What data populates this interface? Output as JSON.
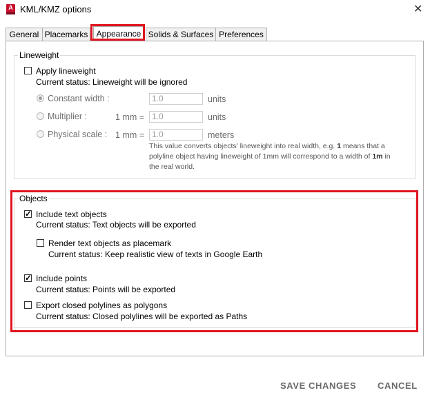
{
  "window": {
    "title": "KML/KMZ options",
    "app_icon_letter": "A"
  },
  "tabs": [
    {
      "label": "General"
    },
    {
      "label": "Placemarks"
    },
    {
      "label": "Appearance"
    },
    {
      "label": "Solids & Surfaces"
    },
    {
      "label": "Preferences"
    }
  ],
  "lineweight": {
    "legend": "Lineweight",
    "apply_label": "Apply lineweight",
    "apply_checked": false,
    "apply_status": "Current status: Lineweight will be ignored",
    "constant": {
      "label": "Constant width :",
      "value": "1.0",
      "unit": "units",
      "selected": true
    },
    "multiplier": {
      "label": "Multiplier :",
      "prefix": "1 mm =",
      "value": "1.0",
      "unit": "units",
      "selected": false
    },
    "physical": {
      "label": "Physical scale :",
      "prefix": "1 mm =",
      "value": "1.0",
      "unit": "meters",
      "selected": false
    },
    "note_1": "This value converts objects' lineweight into real width, e.g.",
    "note_bold_1": "1",
    "note_2": "means that a polyline object having lineweight of 1mm will correspond to a width of",
    "note_bold_2": "1m",
    "note_3": "in the real world."
  },
  "objects": {
    "legend": "Objects",
    "include_text": {
      "label": "Include text objects",
      "checked": true,
      "status": "Current status: Text objects will be exported"
    },
    "render_placemark": {
      "label": "Render text objects as placemark",
      "checked": false,
      "status": "Current status: Keep realistic view of texts in Google Earth"
    },
    "include_points": {
      "label": "Include points",
      "checked": true,
      "status": "Current status: Points will be exported"
    },
    "closed_polygons": {
      "label": "Export closed polylines as polygons",
      "checked": false,
      "status": "Current status: Closed polylines will be exported as Paths"
    }
  },
  "footer": {
    "save_label": "SAVE CHANGES",
    "cancel_label": "CANCEL"
  },
  "colors": {
    "highlight": "#e0141e",
    "accent": "#c8102e"
  }
}
